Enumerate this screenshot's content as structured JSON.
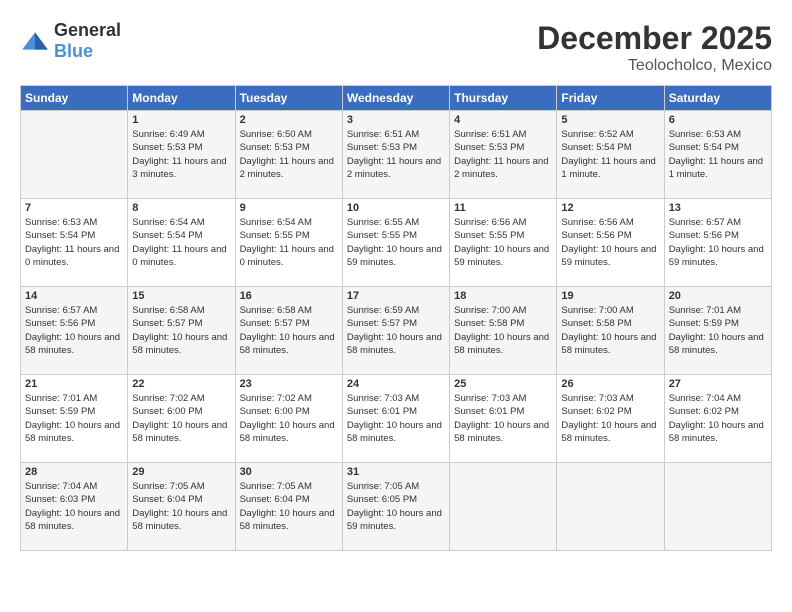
{
  "header": {
    "logo_general": "General",
    "logo_blue": "Blue",
    "month": "December 2025",
    "location": "Teolocholco, Mexico"
  },
  "weekdays": [
    "Sunday",
    "Monday",
    "Tuesday",
    "Wednesday",
    "Thursday",
    "Friday",
    "Saturday"
  ],
  "weeks": [
    [
      {
        "day": "",
        "empty": true
      },
      {
        "day": "1",
        "sunrise": "Sunrise: 6:49 AM",
        "sunset": "Sunset: 5:53 PM",
        "daylight": "Daylight: 11 hours and 3 minutes."
      },
      {
        "day": "2",
        "sunrise": "Sunrise: 6:50 AM",
        "sunset": "Sunset: 5:53 PM",
        "daylight": "Daylight: 11 hours and 2 minutes."
      },
      {
        "day": "3",
        "sunrise": "Sunrise: 6:51 AM",
        "sunset": "Sunset: 5:53 PM",
        "daylight": "Daylight: 11 hours and 2 minutes."
      },
      {
        "day": "4",
        "sunrise": "Sunrise: 6:51 AM",
        "sunset": "Sunset: 5:53 PM",
        "daylight": "Daylight: 11 hours and 2 minutes."
      },
      {
        "day": "5",
        "sunrise": "Sunrise: 6:52 AM",
        "sunset": "Sunset: 5:54 PM",
        "daylight": "Daylight: 11 hours and 1 minute."
      },
      {
        "day": "6",
        "sunrise": "Sunrise: 6:53 AM",
        "sunset": "Sunset: 5:54 PM",
        "daylight": "Daylight: 11 hours and 1 minute."
      }
    ],
    [
      {
        "day": "7",
        "sunrise": "Sunrise: 6:53 AM",
        "sunset": "Sunset: 5:54 PM",
        "daylight": "Daylight: 11 hours and 0 minutes."
      },
      {
        "day": "8",
        "sunrise": "Sunrise: 6:54 AM",
        "sunset": "Sunset: 5:54 PM",
        "daylight": "Daylight: 11 hours and 0 minutes."
      },
      {
        "day": "9",
        "sunrise": "Sunrise: 6:54 AM",
        "sunset": "Sunset: 5:55 PM",
        "daylight": "Daylight: 11 hours and 0 minutes."
      },
      {
        "day": "10",
        "sunrise": "Sunrise: 6:55 AM",
        "sunset": "Sunset: 5:55 PM",
        "daylight": "Daylight: 10 hours and 59 minutes."
      },
      {
        "day": "11",
        "sunrise": "Sunrise: 6:56 AM",
        "sunset": "Sunset: 5:55 PM",
        "daylight": "Daylight: 10 hours and 59 minutes."
      },
      {
        "day": "12",
        "sunrise": "Sunrise: 6:56 AM",
        "sunset": "Sunset: 5:56 PM",
        "daylight": "Daylight: 10 hours and 59 minutes."
      },
      {
        "day": "13",
        "sunrise": "Sunrise: 6:57 AM",
        "sunset": "Sunset: 5:56 PM",
        "daylight": "Daylight: 10 hours and 59 minutes."
      }
    ],
    [
      {
        "day": "14",
        "sunrise": "Sunrise: 6:57 AM",
        "sunset": "Sunset: 5:56 PM",
        "daylight": "Daylight: 10 hours and 58 minutes."
      },
      {
        "day": "15",
        "sunrise": "Sunrise: 6:58 AM",
        "sunset": "Sunset: 5:57 PM",
        "daylight": "Daylight: 10 hours and 58 minutes."
      },
      {
        "day": "16",
        "sunrise": "Sunrise: 6:58 AM",
        "sunset": "Sunset: 5:57 PM",
        "daylight": "Daylight: 10 hours and 58 minutes."
      },
      {
        "day": "17",
        "sunrise": "Sunrise: 6:59 AM",
        "sunset": "Sunset: 5:57 PM",
        "daylight": "Daylight: 10 hours and 58 minutes."
      },
      {
        "day": "18",
        "sunrise": "Sunrise: 7:00 AM",
        "sunset": "Sunset: 5:58 PM",
        "daylight": "Daylight: 10 hours and 58 minutes."
      },
      {
        "day": "19",
        "sunrise": "Sunrise: 7:00 AM",
        "sunset": "Sunset: 5:58 PM",
        "daylight": "Daylight: 10 hours and 58 minutes."
      },
      {
        "day": "20",
        "sunrise": "Sunrise: 7:01 AM",
        "sunset": "Sunset: 5:59 PM",
        "daylight": "Daylight: 10 hours and 58 minutes."
      }
    ],
    [
      {
        "day": "21",
        "sunrise": "Sunrise: 7:01 AM",
        "sunset": "Sunset: 5:59 PM",
        "daylight": "Daylight: 10 hours and 58 minutes."
      },
      {
        "day": "22",
        "sunrise": "Sunrise: 7:02 AM",
        "sunset": "Sunset: 6:00 PM",
        "daylight": "Daylight: 10 hours and 58 minutes."
      },
      {
        "day": "23",
        "sunrise": "Sunrise: 7:02 AM",
        "sunset": "Sunset: 6:00 PM",
        "daylight": "Daylight: 10 hours and 58 minutes."
      },
      {
        "day": "24",
        "sunrise": "Sunrise: 7:03 AM",
        "sunset": "Sunset: 6:01 PM",
        "daylight": "Daylight: 10 hours and 58 minutes."
      },
      {
        "day": "25",
        "sunrise": "Sunrise: 7:03 AM",
        "sunset": "Sunset: 6:01 PM",
        "daylight": "Daylight: 10 hours and 58 minutes."
      },
      {
        "day": "26",
        "sunrise": "Sunrise: 7:03 AM",
        "sunset": "Sunset: 6:02 PM",
        "daylight": "Daylight: 10 hours and 58 minutes."
      },
      {
        "day": "27",
        "sunrise": "Sunrise: 7:04 AM",
        "sunset": "Sunset: 6:02 PM",
        "daylight": "Daylight: 10 hours and 58 minutes."
      }
    ],
    [
      {
        "day": "28",
        "sunrise": "Sunrise: 7:04 AM",
        "sunset": "Sunset: 6:03 PM",
        "daylight": "Daylight: 10 hours and 58 minutes."
      },
      {
        "day": "29",
        "sunrise": "Sunrise: 7:05 AM",
        "sunset": "Sunset: 6:04 PM",
        "daylight": "Daylight: 10 hours and 58 minutes."
      },
      {
        "day": "30",
        "sunrise": "Sunrise: 7:05 AM",
        "sunset": "Sunset: 6:04 PM",
        "daylight": "Daylight: 10 hours and 58 minutes."
      },
      {
        "day": "31",
        "sunrise": "Sunrise: 7:05 AM",
        "sunset": "Sunset: 6:05 PM",
        "daylight": "Daylight: 10 hours and 59 minutes."
      },
      {
        "day": "",
        "empty": true
      },
      {
        "day": "",
        "empty": true
      },
      {
        "day": "",
        "empty": true
      }
    ]
  ]
}
